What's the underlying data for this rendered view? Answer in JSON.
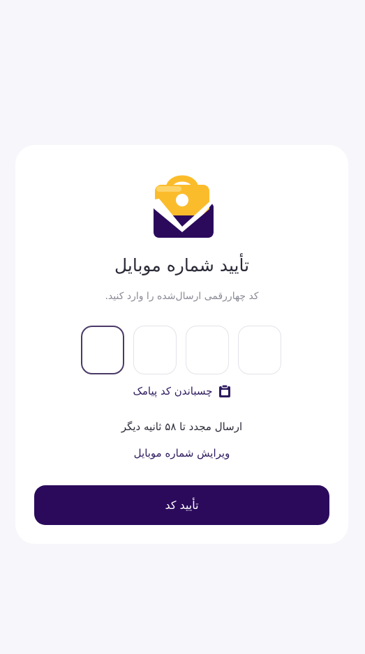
{
  "colors": {
    "background": "#f7f6fb",
    "card": "#ffffff",
    "primary": "#2b0a5c",
    "accent": "#fbbc2c",
    "link": "#2d1a5e"
  },
  "logo": {
    "icon": "lock-bag-check-logo"
  },
  "title": "تأیید شماره موبایل",
  "subtitle": "کد چهاررقمی ارسال‌شده را وارد کنید.",
  "otp": {
    "digits": [
      "",
      "",
      "",
      ""
    ],
    "active_index": 0
  },
  "paste": {
    "label": "چسباندن کد پیامک",
    "icon": "clipboard-icon"
  },
  "resend": {
    "text": "ارسال مجدد تا ۵۸ ثانیه دیگر"
  },
  "edit": {
    "label": "ویرایش شماره موبایل"
  },
  "confirm": {
    "label": "تأیید کد"
  }
}
